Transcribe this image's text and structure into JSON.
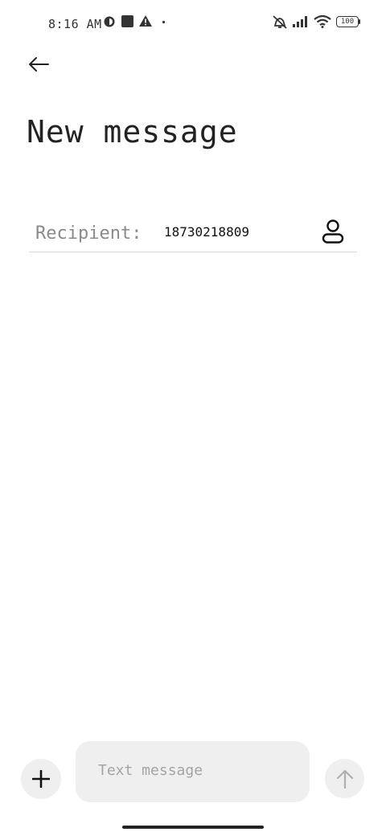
{
  "status_bar": {
    "time": "8:16 AM",
    "battery": "100"
  },
  "header": {
    "title": "New message"
  },
  "recipient": {
    "label": "Recipient:",
    "value": "18730218809"
  },
  "compose": {
    "placeholder": "Text message"
  }
}
